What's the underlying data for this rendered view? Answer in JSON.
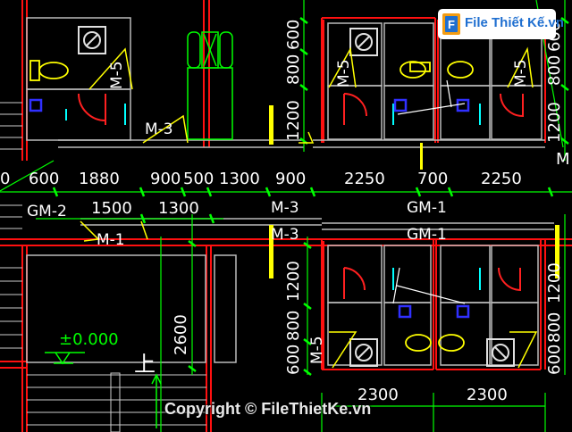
{
  "watermark": {
    "logo_text": "File Thiết Kế.vn",
    "copyright_text": "Copyright © FileThietKe.vn"
  },
  "colors": {
    "background": "#000000",
    "wall": "#ff1010",
    "dimension": "#00ff00",
    "fixture": "#ffff00",
    "door": "#ff2020",
    "drain": "#2020ff",
    "text": "#ffffff"
  },
  "dimensions": {
    "top_row": [
      "600",
      "1880",
      "900",
      "500",
      "1300",
      "900",
      "2250",
      "700",
      "2250"
    ],
    "second_row": [
      "1500",
      "1300"
    ],
    "right_vertical_upper": [
      "800",
      "600",
      "1200"
    ],
    "right_vertical_lower": [
      "1200",
      "800",
      "600"
    ],
    "left_vertical": [
      "600",
      "800",
      "1200",
      "800",
      "600"
    ],
    "stair_height": "2600",
    "bottom_row": [
      "2300",
      "2300"
    ],
    "edge_left": "0",
    "edge_right": "M"
  },
  "door_tags": {
    "gm2": "GM-2",
    "m1": "M-1",
    "m3_upper": "M-3",
    "m3_center_a": "M-3",
    "m3_center_b": "M-3",
    "gm1_a": "GM-1",
    "gm1_b": "GM-1",
    "m5_a": "M-5",
    "m5_b": "M-5",
    "m5_c": "M-5",
    "m5_d": "M-5"
  },
  "level_mark": "±0.000",
  "stair_label": "上",
  "icons": [
    "toilet-icon",
    "wash-basin-icon",
    "floor-drain-icon",
    "door-swing-icon",
    "level-symbol-icon",
    "stair-arrow-icon"
  ]
}
